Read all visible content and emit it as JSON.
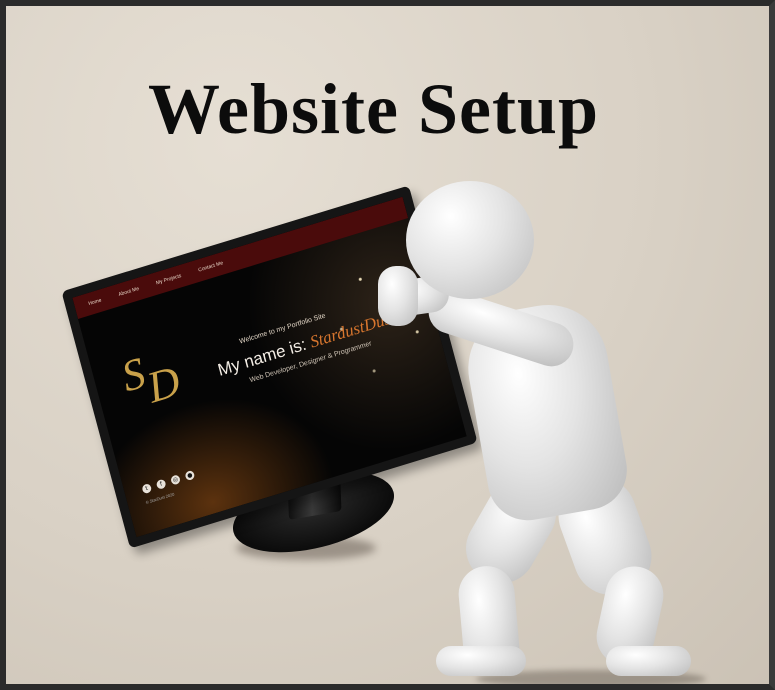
{
  "title": "Website Setup",
  "screen": {
    "nav": [
      "Home",
      "About Me",
      "My Projects",
      "Contact Me"
    ],
    "logo_text": [
      "S",
      "D"
    ],
    "welcome": "Welcome to my Portfolio Site",
    "name_prefix": "My name is:",
    "name_accent": "StardustDust",
    "roles": "Web Developer, Designer & Programmer",
    "social_icons": [
      "twitter-icon",
      "facebook-icon",
      "instagram-icon",
      "github-icon"
    ],
    "copyright": "© StarDust 2020"
  },
  "colors": {
    "nav_bar": "#4a0b0b",
    "accent_name": "#d8762e",
    "logo_gold": "#c9a14a",
    "background": "#d9d1c5"
  }
}
